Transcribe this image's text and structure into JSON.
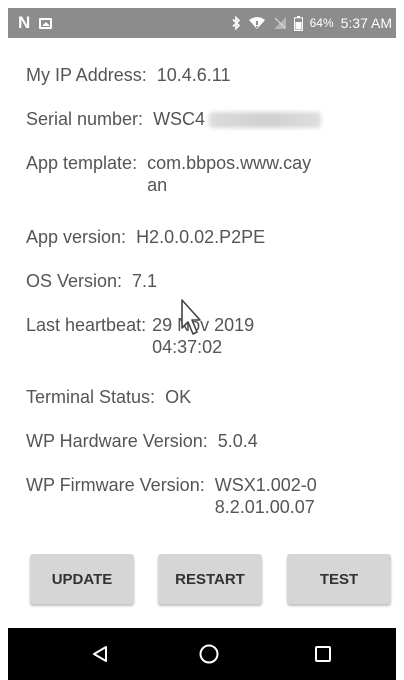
{
  "status_bar": {
    "battery": "64%",
    "time": "5:37 AM"
  },
  "info": {
    "ip_label": "My IP Address:",
    "ip_value": "10.4.6.11",
    "serial_label": "Serial number:",
    "serial_value": "WSC4",
    "template_label": "App template:",
    "template_value_1": "com.bbpos.www.cay",
    "template_value_2": "an",
    "version_label": "App version:",
    "version_value": "H2.0.0.02.P2PE",
    "os_label": "OS Version:",
    "os_value": "7.1",
    "heartbeat_label": "Last heartbeat:",
    "heartbeat_value_1": "29 Nov 2019",
    "heartbeat_value_2": "04:37:02",
    "terminal_label": "Terminal Status:",
    "terminal_value": "OK",
    "hw_label": "WP Hardware Version:",
    "hw_value": "5.0.4",
    "fw_label": "WP Firmware Version:",
    "fw_value_1": "WSX1.002-0",
    "fw_value_2": "8.2.01.00.07"
  },
  "buttons": {
    "update": "UPDATE",
    "restart": "RESTART",
    "test": "TEST"
  },
  "icons": {
    "status_left": [
      "n-icon",
      "image-icon"
    ],
    "status_right": [
      "bluetooth-icon",
      "wifi-icon",
      "no-signal-icon",
      "battery-icon"
    ],
    "nav": [
      "back-icon",
      "home-icon",
      "recents-icon"
    ]
  }
}
